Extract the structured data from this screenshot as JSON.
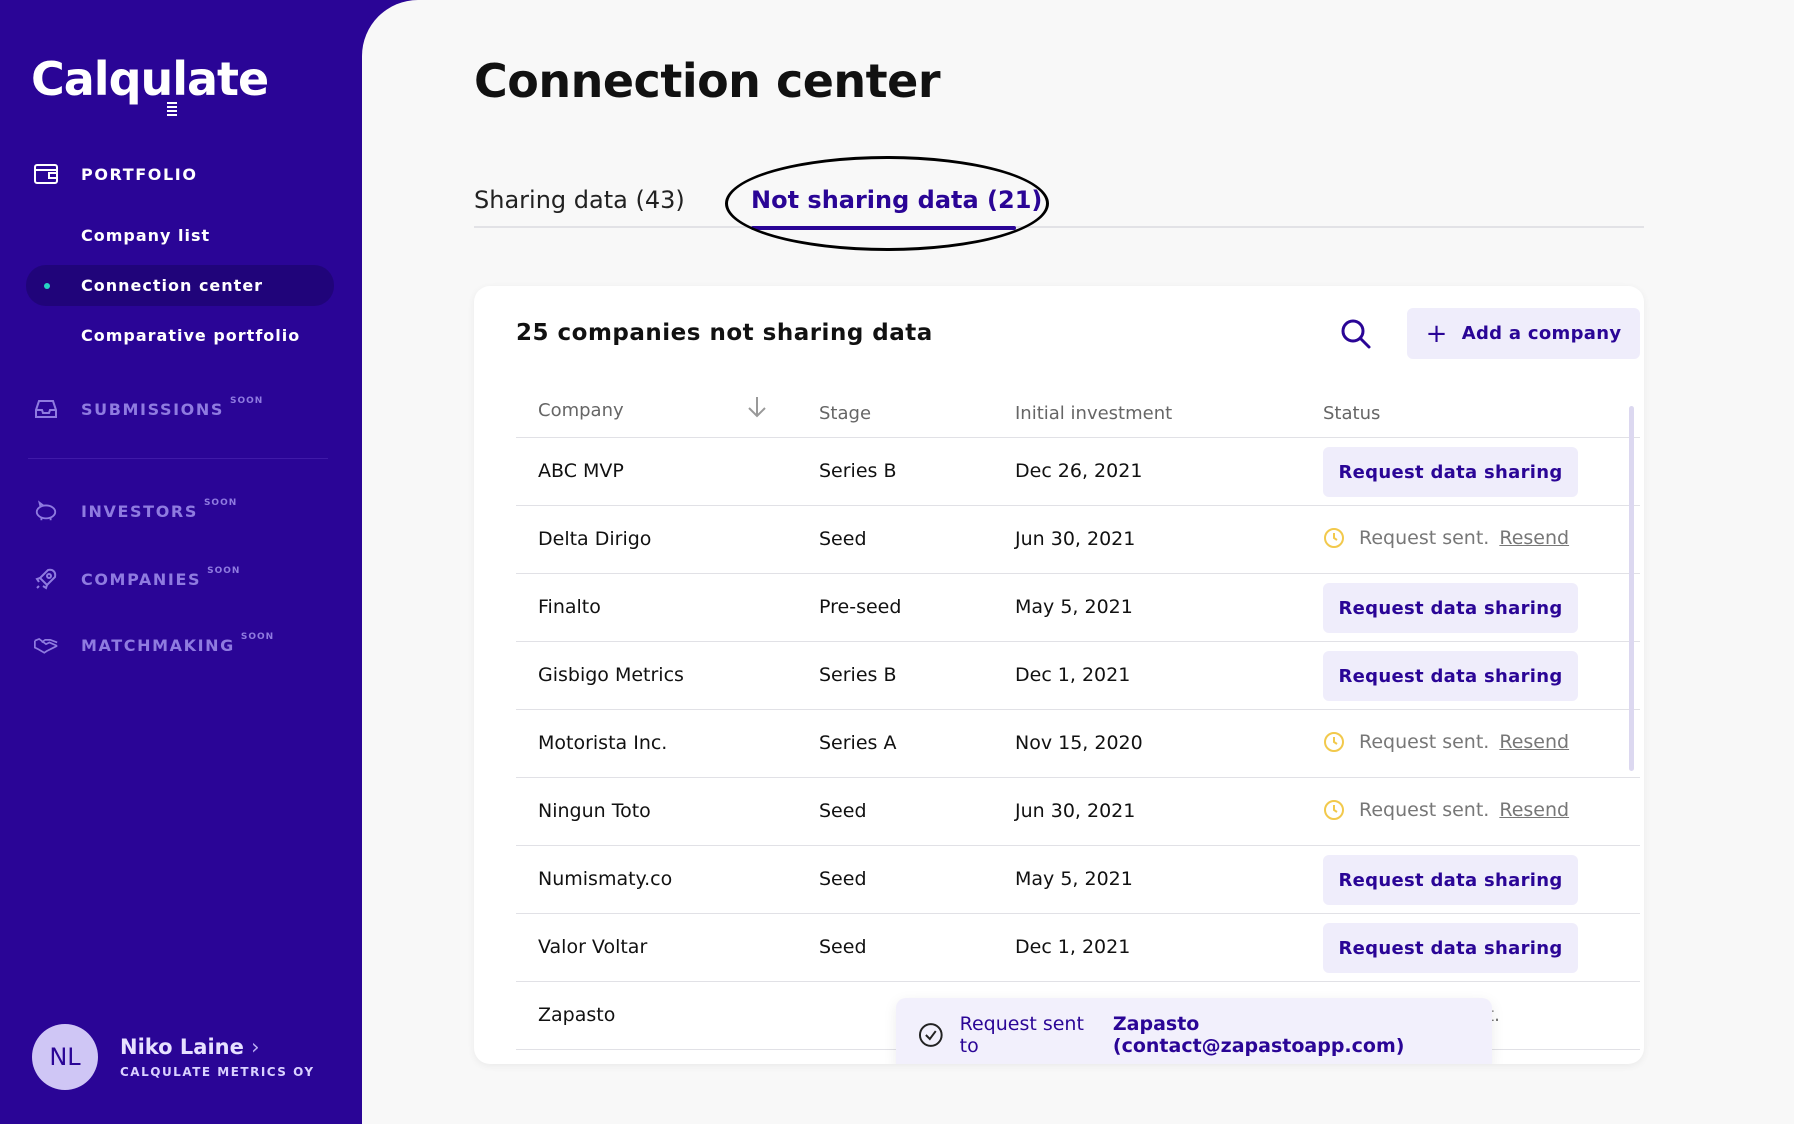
{
  "app": {
    "name": "Calqulate"
  },
  "sidebar": {
    "portfolio": "PORTFOLIO",
    "sub_items": [
      "Company list",
      "Connection center",
      "Comparative portfolio"
    ],
    "sections": [
      {
        "label": "SUBMISSIONS",
        "badge": "SOON"
      },
      {
        "label": "INVESTORS",
        "badge": "SOON"
      },
      {
        "label": "COMPANIES",
        "badge": "SOON"
      },
      {
        "label": "MATCHMAKING",
        "badge": "SOON"
      }
    ],
    "user": {
      "initials": "NL",
      "name": "Niko Laine",
      "org": "CALQULATE METRICS OY"
    }
  },
  "page": {
    "title": "Connection center"
  },
  "tabs": [
    {
      "label": "Sharing data (43)"
    },
    {
      "label": "Not sharing data (21)",
      "active": true
    }
  ],
  "card": {
    "title": "25 companies not sharing data",
    "add_button": "Add a company",
    "columns": [
      "Company",
      "Stage",
      "Initial investment",
      "Status"
    ],
    "rows": [
      {
        "company": "ABC MVP",
        "stage": "Series B",
        "date": "Dec 26, 2021",
        "status": "button",
        "label": "Request data sharing"
      },
      {
        "company": "Delta Dirigo",
        "stage": "Seed",
        "date": "Jun 30, 2021",
        "status": "sent",
        "label": "Request sent.",
        "link": "Resend"
      },
      {
        "company": "Finalto",
        "stage": "Pre-seed",
        "date": "May 5, 2021",
        "status": "button",
        "label": "Request data sharing"
      },
      {
        "company": "Gisbigo Metrics",
        "stage": "Series B",
        "date": "Dec 1, 2021",
        "status": "button",
        "label": "Request data sharing"
      },
      {
        "company": "Motorista Inc.",
        "stage": "Series A",
        "date": "Nov 15, 2020",
        "status": "sent",
        "label": "Request sent.",
        "link": "Resend"
      },
      {
        "company": "Ningun Toto",
        "stage": "Seed",
        "date": "Jun 30, 2021",
        "status": "sent",
        "label": "Request sent.",
        "link": "Resend"
      },
      {
        "company": "Numismaty.co",
        "stage": "Seed",
        "date": "May 5, 2021",
        "status": "button",
        "label": "Request data sharing"
      },
      {
        "company": "Valor Voltar",
        "stage": "Seed",
        "date": "Dec 1, 2021",
        "status": "button",
        "label": "Request data sharing"
      },
      {
        "company": "Zapasto",
        "stage": "",
        "date": "",
        "status": "text",
        "label": "equest resent."
      }
    ]
  },
  "toast": {
    "prefix": "Request sent to",
    "target": "Zapasto (contact@zapastoapp.com)"
  },
  "colors": {
    "brand": "#2a0596",
    "accent_soft": "#efedfb",
    "clock": "#f2c94c",
    "teal": "#27d4c4"
  }
}
